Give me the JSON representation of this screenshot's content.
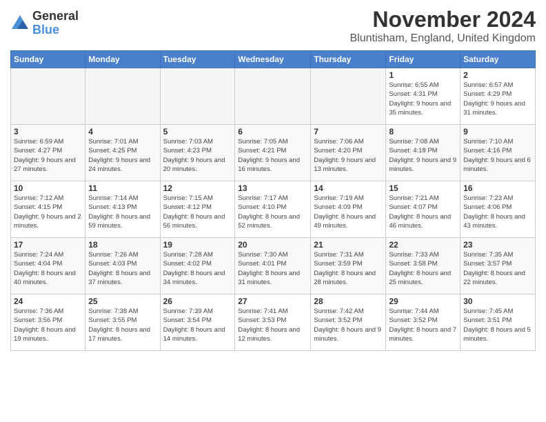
{
  "logo": {
    "general": "General",
    "blue": "Blue"
  },
  "header": {
    "month": "November 2024",
    "location": "Bluntisham, England, United Kingdom"
  },
  "days_of_week": [
    "Sunday",
    "Monday",
    "Tuesday",
    "Wednesday",
    "Thursday",
    "Friday",
    "Saturday"
  ],
  "weeks": [
    [
      {
        "day": "",
        "info": ""
      },
      {
        "day": "",
        "info": ""
      },
      {
        "day": "",
        "info": ""
      },
      {
        "day": "",
        "info": ""
      },
      {
        "day": "",
        "info": ""
      },
      {
        "day": "1",
        "info": "Sunrise: 6:55 AM\nSunset: 4:31 PM\nDaylight: 9 hours and 35 minutes."
      },
      {
        "day": "2",
        "info": "Sunrise: 6:57 AM\nSunset: 4:29 PM\nDaylight: 9 hours and 31 minutes."
      }
    ],
    [
      {
        "day": "3",
        "info": "Sunrise: 6:59 AM\nSunset: 4:27 PM\nDaylight: 9 hours and 27 minutes."
      },
      {
        "day": "4",
        "info": "Sunrise: 7:01 AM\nSunset: 4:25 PM\nDaylight: 9 hours and 24 minutes."
      },
      {
        "day": "5",
        "info": "Sunrise: 7:03 AM\nSunset: 4:23 PM\nDaylight: 9 hours and 20 minutes."
      },
      {
        "day": "6",
        "info": "Sunrise: 7:05 AM\nSunset: 4:21 PM\nDaylight: 9 hours and 16 minutes."
      },
      {
        "day": "7",
        "info": "Sunrise: 7:06 AM\nSunset: 4:20 PM\nDaylight: 9 hours and 13 minutes."
      },
      {
        "day": "8",
        "info": "Sunrise: 7:08 AM\nSunset: 4:18 PM\nDaylight: 9 hours and 9 minutes."
      },
      {
        "day": "9",
        "info": "Sunrise: 7:10 AM\nSunset: 4:16 PM\nDaylight: 9 hours and 6 minutes."
      }
    ],
    [
      {
        "day": "10",
        "info": "Sunrise: 7:12 AM\nSunset: 4:15 PM\nDaylight: 9 hours and 2 minutes."
      },
      {
        "day": "11",
        "info": "Sunrise: 7:14 AM\nSunset: 4:13 PM\nDaylight: 8 hours and 59 minutes."
      },
      {
        "day": "12",
        "info": "Sunrise: 7:15 AM\nSunset: 4:12 PM\nDaylight: 8 hours and 56 minutes."
      },
      {
        "day": "13",
        "info": "Sunrise: 7:17 AM\nSunset: 4:10 PM\nDaylight: 8 hours and 52 minutes."
      },
      {
        "day": "14",
        "info": "Sunrise: 7:19 AM\nSunset: 4:09 PM\nDaylight: 8 hours and 49 minutes."
      },
      {
        "day": "15",
        "info": "Sunrise: 7:21 AM\nSunset: 4:07 PM\nDaylight: 8 hours and 46 minutes."
      },
      {
        "day": "16",
        "info": "Sunrise: 7:23 AM\nSunset: 4:06 PM\nDaylight: 8 hours and 43 minutes."
      }
    ],
    [
      {
        "day": "17",
        "info": "Sunrise: 7:24 AM\nSunset: 4:04 PM\nDaylight: 8 hours and 40 minutes."
      },
      {
        "day": "18",
        "info": "Sunrise: 7:26 AM\nSunset: 4:03 PM\nDaylight: 8 hours and 37 minutes."
      },
      {
        "day": "19",
        "info": "Sunrise: 7:28 AM\nSunset: 4:02 PM\nDaylight: 8 hours and 34 minutes."
      },
      {
        "day": "20",
        "info": "Sunrise: 7:30 AM\nSunset: 4:01 PM\nDaylight: 8 hours and 31 minutes."
      },
      {
        "day": "21",
        "info": "Sunrise: 7:31 AM\nSunset: 3:59 PM\nDaylight: 8 hours and 28 minutes."
      },
      {
        "day": "22",
        "info": "Sunrise: 7:33 AM\nSunset: 3:58 PM\nDaylight: 8 hours and 25 minutes."
      },
      {
        "day": "23",
        "info": "Sunrise: 7:35 AM\nSunset: 3:57 PM\nDaylight: 8 hours and 22 minutes."
      }
    ],
    [
      {
        "day": "24",
        "info": "Sunrise: 7:36 AM\nSunset: 3:56 PM\nDaylight: 8 hours and 19 minutes."
      },
      {
        "day": "25",
        "info": "Sunrise: 7:38 AM\nSunset: 3:55 PM\nDaylight: 8 hours and 17 minutes."
      },
      {
        "day": "26",
        "info": "Sunrise: 7:39 AM\nSunset: 3:54 PM\nDaylight: 8 hours and 14 minutes."
      },
      {
        "day": "27",
        "info": "Sunrise: 7:41 AM\nSunset: 3:53 PM\nDaylight: 8 hours and 12 minutes."
      },
      {
        "day": "28",
        "info": "Sunrise: 7:42 AM\nSunset: 3:52 PM\nDaylight: 8 hours and 9 minutes."
      },
      {
        "day": "29",
        "info": "Sunrise: 7:44 AM\nSunset: 3:52 PM\nDaylight: 8 hours and 7 minutes."
      },
      {
        "day": "30",
        "info": "Sunrise: 7:45 AM\nSunset: 3:51 PM\nDaylight: 8 hours and 5 minutes."
      }
    ]
  ]
}
